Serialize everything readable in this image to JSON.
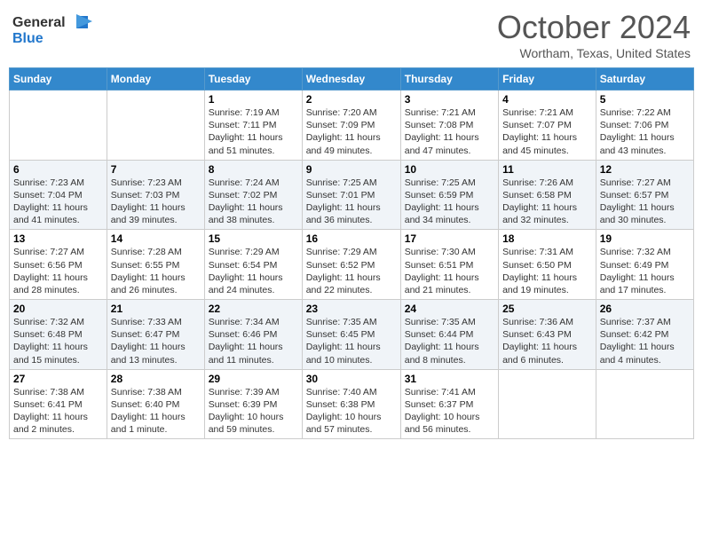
{
  "header": {
    "logo_line1": "General",
    "logo_line2": "Blue",
    "month": "October 2024",
    "location": "Wortham, Texas, United States"
  },
  "weekdays": [
    "Sunday",
    "Monday",
    "Tuesday",
    "Wednesday",
    "Thursday",
    "Friday",
    "Saturday"
  ],
  "weeks": [
    [
      {
        "day": "",
        "info": ""
      },
      {
        "day": "",
        "info": ""
      },
      {
        "day": "1",
        "info": "Sunrise: 7:19 AM\nSunset: 7:11 PM\nDaylight: 11 hours and 51 minutes."
      },
      {
        "day": "2",
        "info": "Sunrise: 7:20 AM\nSunset: 7:09 PM\nDaylight: 11 hours and 49 minutes."
      },
      {
        "day": "3",
        "info": "Sunrise: 7:21 AM\nSunset: 7:08 PM\nDaylight: 11 hours and 47 minutes."
      },
      {
        "day": "4",
        "info": "Sunrise: 7:21 AM\nSunset: 7:07 PM\nDaylight: 11 hours and 45 minutes."
      },
      {
        "day": "5",
        "info": "Sunrise: 7:22 AM\nSunset: 7:06 PM\nDaylight: 11 hours and 43 minutes."
      }
    ],
    [
      {
        "day": "6",
        "info": "Sunrise: 7:23 AM\nSunset: 7:04 PM\nDaylight: 11 hours and 41 minutes."
      },
      {
        "day": "7",
        "info": "Sunrise: 7:23 AM\nSunset: 7:03 PM\nDaylight: 11 hours and 39 minutes."
      },
      {
        "day": "8",
        "info": "Sunrise: 7:24 AM\nSunset: 7:02 PM\nDaylight: 11 hours and 38 minutes."
      },
      {
        "day": "9",
        "info": "Sunrise: 7:25 AM\nSunset: 7:01 PM\nDaylight: 11 hours and 36 minutes."
      },
      {
        "day": "10",
        "info": "Sunrise: 7:25 AM\nSunset: 6:59 PM\nDaylight: 11 hours and 34 minutes."
      },
      {
        "day": "11",
        "info": "Sunrise: 7:26 AM\nSunset: 6:58 PM\nDaylight: 11 hours and 32 minutes."
      },
      {
        "day": "12",
        "info": "Sunrise: 7:27 AM\nSunset: 6:57 PM\nDaylight: 11 hours and 30 minutes."
      }
    ],
    [
      {
        "day": "13",
        "info": "Sunrise: 7:27 AM\nSunset: 6:56 PM\nDaylight: 11 hours and 28 minutes."
      },
      {
        "day": "14",
        "info": "Sunrise: 7:28 AM\nSunset: 6:55 PM\nDaylight: 11 hours and 26 minutes."
      },
      {
        "day": "15",
        "info": "Sunrise: 7:29 AM\nSunset: 6:54 PM\nDaylight: 11 hours and 24 minutes."
      },
      {
        "day": "16",
        "info": "Sunrise: 7:29 AM\nSunset: 6:52 PM\nDaylight: 11 hours and 22 minutes."
      },
      {
        "day": "17",
        "info": "Sunrise: 7:30 AM\nSunset: 6:51 PM\nDaylight: 11 hours and 21 minutes."
      },
      {
        "day": "18",
        "info": "Sunrise: 7:31 AM\nSunset: 6:50 PM\nDaylight: 11 hours and 19 minutes."
      },
      {
        "day": "19",
        "info": "Sunrise: 7:32 AM\nSunset: 6:49 PM\nDaylight: 11 hours and 17 minutes."
      }
    ],
    [
      {
        "day": "20",
        "info": "Sunrise: 7:32 AM\nSunset: 6:48 PM\nDaylight: 11 hours and 15 minutes."
      },
      {
        "day": "21",
        "info": "Sunrise: 7:33 AM\nSunset: 6:47 PM\nDaylight: 11 hours and 13 minutes."
      },
      {
        "day": "22",
        "info": "Sunrise: 7:34 AM\nSunset: 6:46 PM\nDaylight: 11 hours and 11 minutes."
      },
      {
        "day": "23",
        "info": "Sunrise: 7:35 AM\nSunset: 6:45 PM\nDaylight: 11 hours and 10 minutes."
      },
      {
        "day": "24",
        "info": "Sunrise: 7:35 AM\nSunset: 6:44 PM\nDaylight: 11 hours and 8 minutes."
      },
      {
        "day": "25",
        "info": "Sunrise: 7:36 AM\nSunset: 6:43 PM\nDaylight: 11 hours and 6 minutes."
      },
      {
        "day": "26",
        "info": "Sunrise: 7:37 AM\nSunset: 6:42 PM\nDaylight: 11 hours and 4 minutes."
      }
    ],
    [
      {
        "day": "27",
        "info": "Sunrise: 7:38 AM\nSunset: 6:41 PM\nDaylight: 11 hours and 2 minutes."
      },
      {
        "day": "28",
        "info": "Sunrise: 7:38 AM\nSunset: 6:40 PM\nDaylight: 11 hours and 1 minute."
      },
      {
        "day": "29",
        "info": "Sunrise: 7:39 AM\nSunset: 6:39 PM\nDaylight: 10 hours and 59 minutes."
      },
      {
        "day": "30",
        "info": "Sunrise: 7:40 AM\nSunset: 6:38 PM\nDaylight: 10 hours and 57 minutes."
      },
      {
        "day": "31",
        "info": "Sunrise: 7:41 AM\nSunset: 6:37 PM\nDaylight: 10 hours and 56 minutes."
      },
      {
        "day": "",
        "info": ""
      },
      {
        "day": "",
        "info": ""
      }
    ]
  ]
}
